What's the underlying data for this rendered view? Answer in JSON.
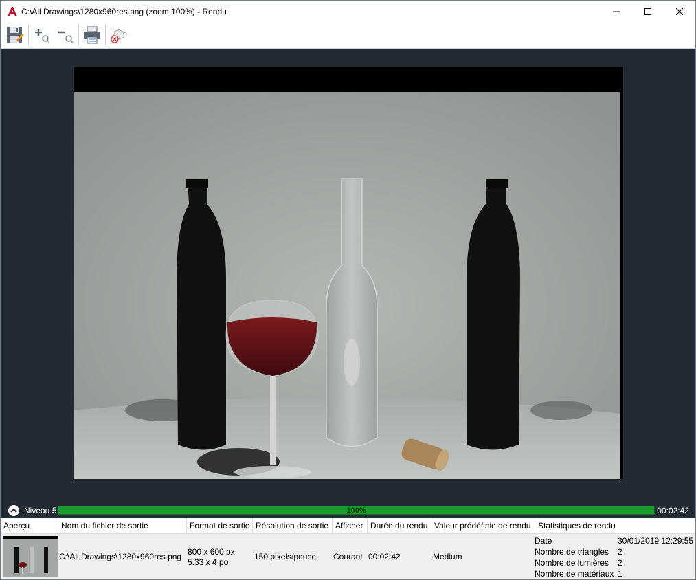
{
  "window": {
    "title": "C:\\All Drawings\\1280x960res.png (zoom 100%) - Rendu",
    "app_icon": "autocad-a-icon",
    "controls": [
      "minimize-icon",
      "maximize-icon",
      "close-icon"
    ]
  },
  "toolbar": {
    "buttons": [
      {
        "name": "save-button",
        "icon": "floppy-disk-icon"
      },
      {
        "name": "zoom-in-button",
        "icon": "zoom-in-icon"
      },
      {
        "name": "zoom-out-button",
        "icon": "zoom-out-icon"
      },
      {
        "name": "print-button",
        "icon": "printer-icon"
      },
      {
        "name": "cancel-render-button",
        "icon": "teapot-cancel-icon"
      }
    ]
  },
  "progress": {
    "level_label": "Niveau 5",
    "percent_text": "100%",
    "percent": 100,
    "elapsed": "00:02:42",
    "color": "#1a9b2e"
  },
  "history": {
    "columns": [
      "Aperçu",
      "Nom du fichier de sortie",
      "Format de sortie",
      "Résolution de sortie",
      "Afficher",
      "Durée du rendu",
      "Valeur prédéfinie de rendu",
      "Statistiques de rendu"
    ],
    "row": {
      "file": "C:\\All Drawings\\1280x960res.png",
      "format_px": "800 x 600 px",
      "format_in": "5.33 x 4 po",
      "resolution": "150 pixels/pouce",
      "show": "Courant",
      "duration": "00:02:42",
      "preset": "Medium",
      "stats": [
        {
          "label": "Date",
          "value": "30/01/2019 12:29:55"
        },
        {
          "label": "Nombre de triangles",
          "value": "2"
        },
        {
          "label": "Nombre de lumières",
          "value": "2"
        },
        {
          "label": "Nombre de matériaux",
          "value": "1"
        }
      ]
    }
  },
  "colors": {
    "viewport_bg": "#222a34",
    "accent_red": "#c8102e"
  }
}
